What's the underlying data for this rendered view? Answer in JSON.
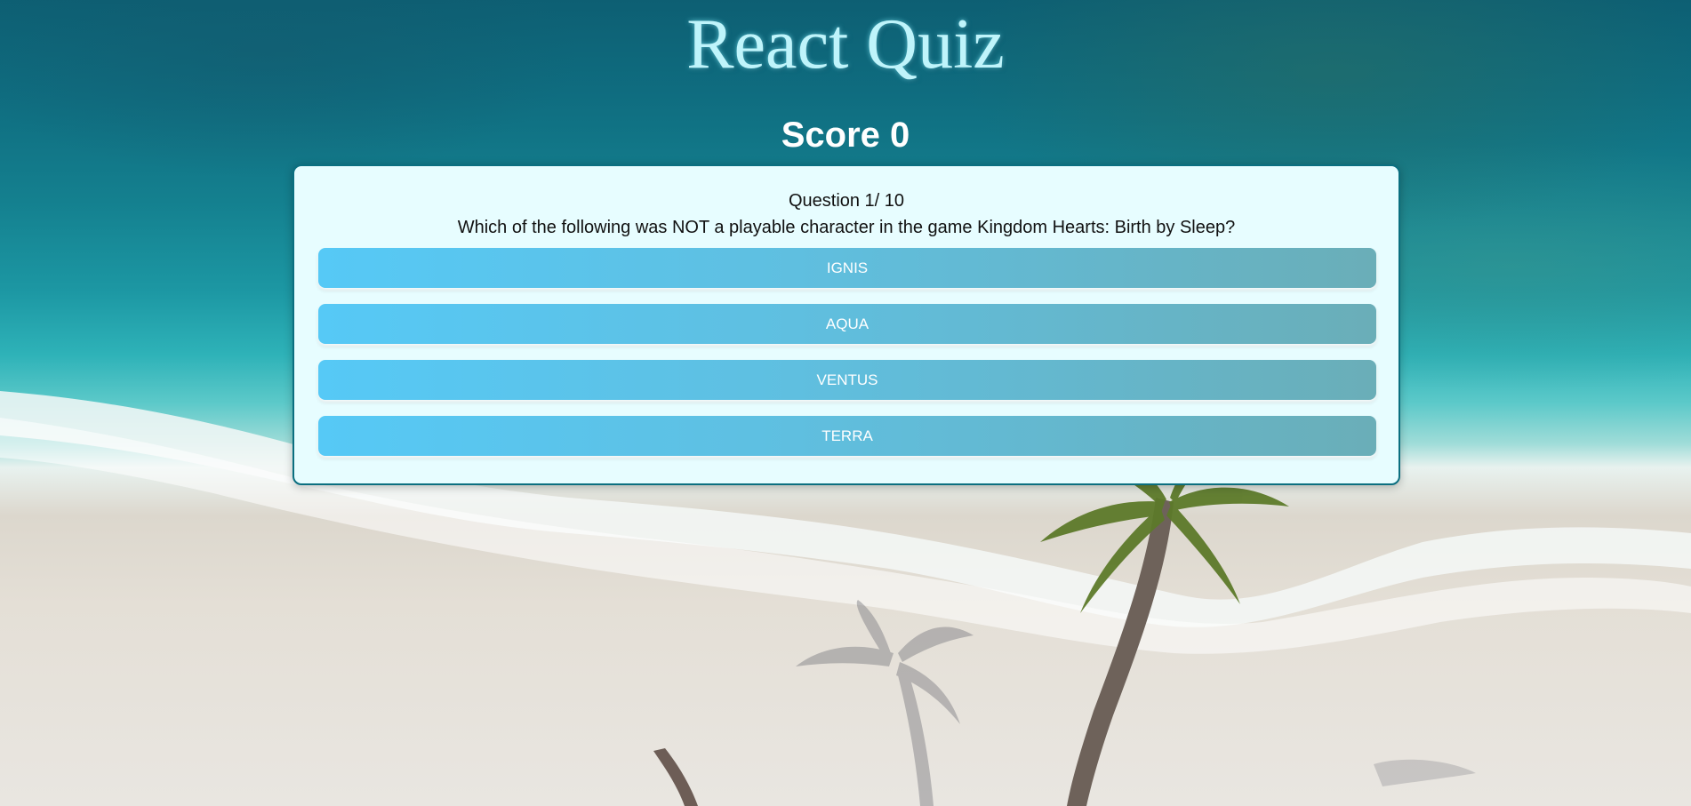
{
  "app": {
    "title": "React Quiz"
  },
  "score": {
    "text": "Score 0"
  },
  "quiz": {
    "question_number_text": "Question 1/ 10",
    "question_text": "Which of the following was NOT a playable character in the game Kingdom Hearts: Birth by Sleep?",
    "answers": [
      {
        "label": "IGNIS"
      },
      {
        "label": "AQUA"
      },
      {
        "label": "VENTUS"
      },
      {
        "label": "TERRA"
      }
    ]
  },
  "theme": {
    "title_color": "#bff4fb",
    "card_background": "#e7fdff",
    "card_border": "#0b6f80",
    "answer_gradient_start": "#56c9f6",
    "answer_gradient_end": "#6aaeb8"
  },
  "background": {
    "icon": "beach-palm-tree-image"
  }
}
